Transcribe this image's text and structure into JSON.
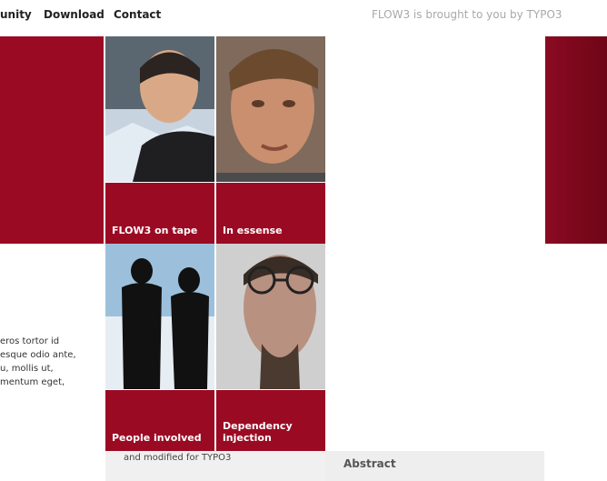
{
  "nav": {
    "items": [
      {
        "label": "unity"
      },
      {
        "label": "Download"
      },
      {
        "label": "Contact"
      }
    ]
  },
  "credit_text": "FLOW3 is brought to you by TYPO3",
  "tiles": [
    {
      "label": "FLOW3 on tape"
    },
    {
      "label": "In essense"
    },
    {
      "label": "People involved"
    },
    {
      "label": "Dependency\ninjection"
    }
  ],
  "body_text": "eros tortor id\nesque odio ante,\nu, mollis ut,\nmentum eget,",
  "caption_text": "and modified for TYPO3",
  "abstract_heading": "Abstract",
  "colors": {
    "brand_red": "#9b0a23",
    "dark_red": "#6f0617"
  }
}
